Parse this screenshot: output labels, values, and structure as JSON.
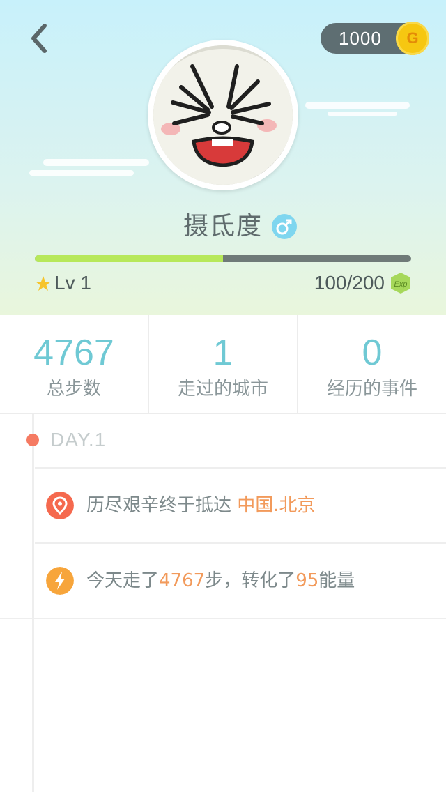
{
  "header": {
    "back_icon": "chevron-left-icon",
    "coins": "1000",
    "coin_icon": "G",
    "username": "摄氐度",
    "gender_icon": "male-icon",
    "level": "Lv 1",
    "exp": "100/200",
    "exp_badge": "Exp",
    "exp_progress": 0.5,
    "colors": {
      "progress_fill": "#b7e85a",
      "progress_track": "#6f7a78",
      "coin": "#f6c711"
    }
  },
  "stats": [
    {
      "value": "4767",
      "label": "总步数"
    },
    {
      "value": "1",
      "label": "走过的城市"
    },
    {
      "value": "0",
      "label": "经历的事件"
    }
  ],
  "timeline": {
    "day_label": "DAY.1",
    "events": [
      {
        "icon": "location-pin-icon",
        "prefix": "历尽艰辛终于抵达 ",
        "highlight": "中国.北京"
      },
      {
        "icon": "lightning-icon",
        "part1": "今天走了",
        "steps": "4767",
        "part2": "步，转化了",
        "energy": "95",
        "part3": "能量"
      }
    ]
  }
}
